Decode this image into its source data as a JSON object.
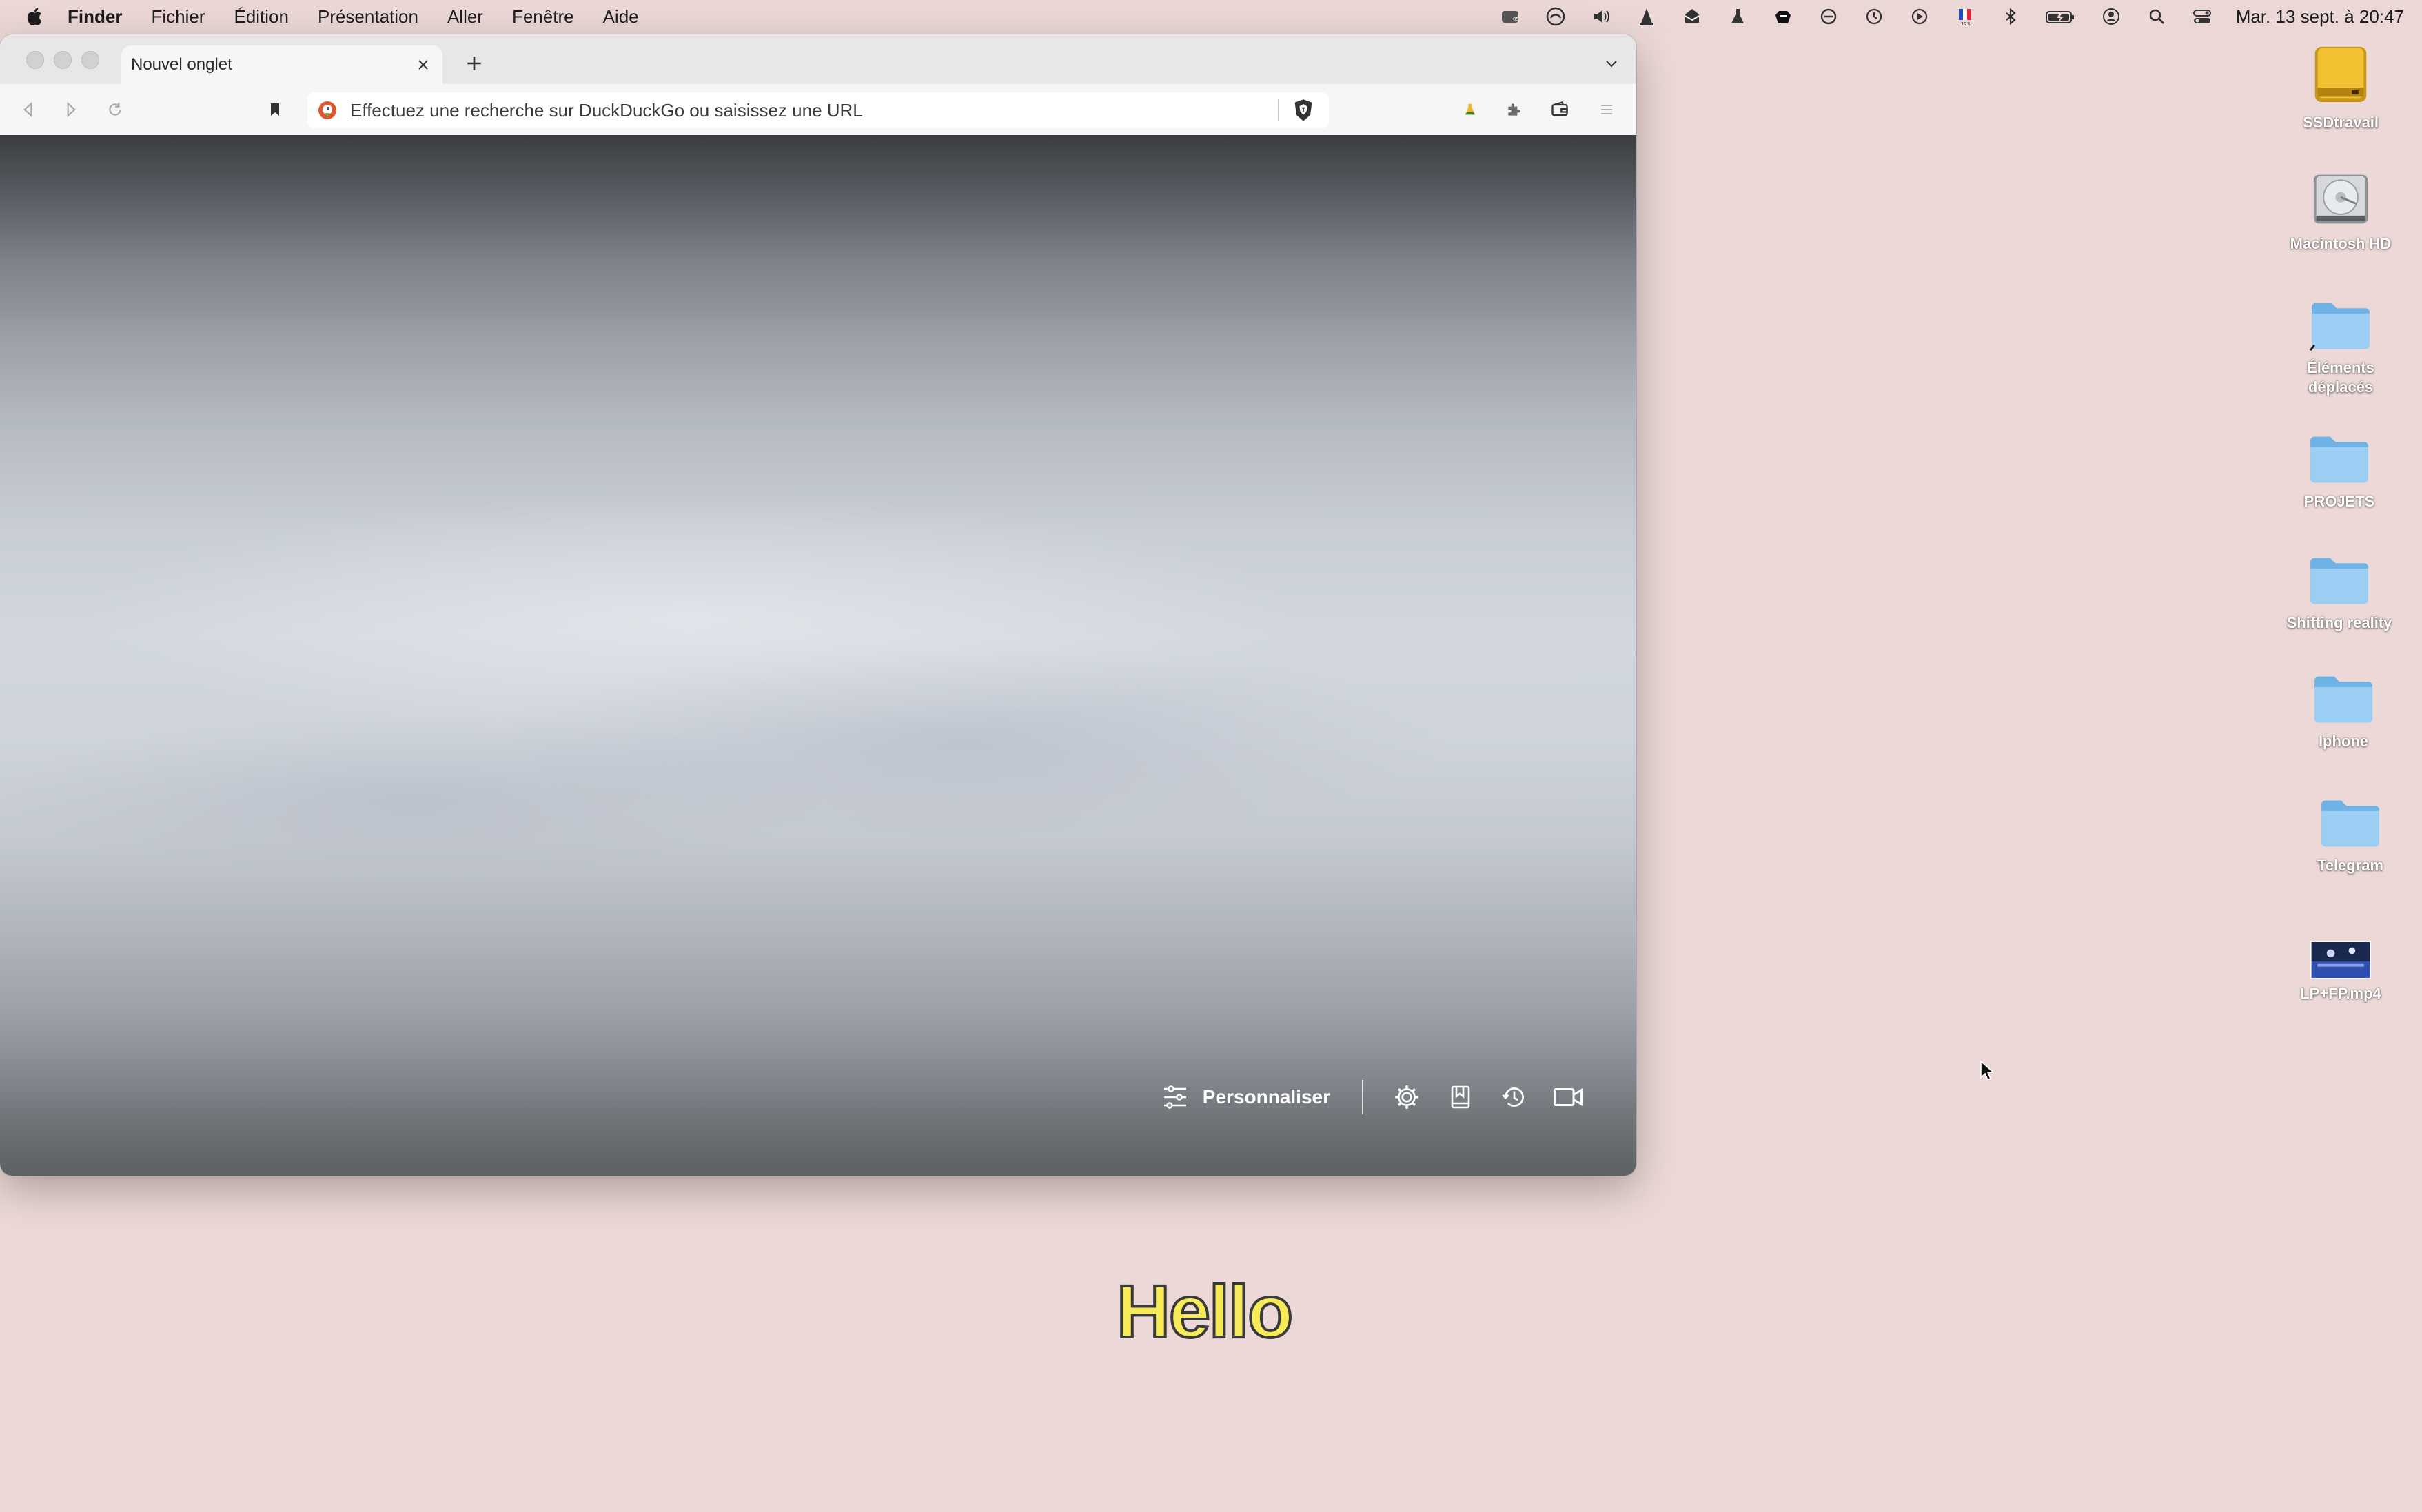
{
  "menubar": {
    "app_name": "Finder",
    "menus": [
      "Fichier",
      "Édition",
      "Présentation",
      "Aller",
      "Fenêtre",
      "Aide"
    ],
    "clock": "Mar. 13 sept. à 20:47",
    "status_icons": [
      "plex-icon",
      "creative-cloud-icon",
      "volume-icon",
      "vlc-icon",
      "mail-icon",
      "flask-icon",
      "dropbox-icon",
      "sync-icon",
      "time-machine-icon",
      "play-icon",
      "flag-fr-icon",
      "bluetooth-icon",
      "battery-icon",
      "user-icon",
      "search-icon",
      "control-center-icon"
    ]
  },
  "browser": {
    "tab_title": "Nouvel onglet",
    "url_placeholder": "Effectuez une recherche sur DuckDuckGo ou saisissez une URL",
    "customize_label": "Personnaliser"
  },
  "desktop": {
    "items": [
      {
        "label": "SSDtravail",
        "icon": "drive-icon"
      },
      {
        "label": "Macintosh HD",
        "icon": "hard-disk-icon"
      },
      {
        "label": "Éléments déplacés",
        "icon": "folder-alias-icon"
      },
      {
        "label": "PROJETS",
        "icon": "folder-icon"
      },
      {
        "label": "Shifting reality",
        "icon": "folder-icon"
      },
      {
        "label": "Iphone",
        "icon": "folder-icon"
      },
      {
        "label": "Telegram",
        "icon": "folder-icon"
      },
      {
        "label": "LP+FP.mp4",
        "icon": "video-thumbnail"
      }
    ],
    "overlay_text": "Hello"
  },
  "colors": {
    "desktop_bg": "#ecd9d7",
    "folder_blue": "#8cc3ee",
    "hello_fill": "#f6ea58"
  }
}
